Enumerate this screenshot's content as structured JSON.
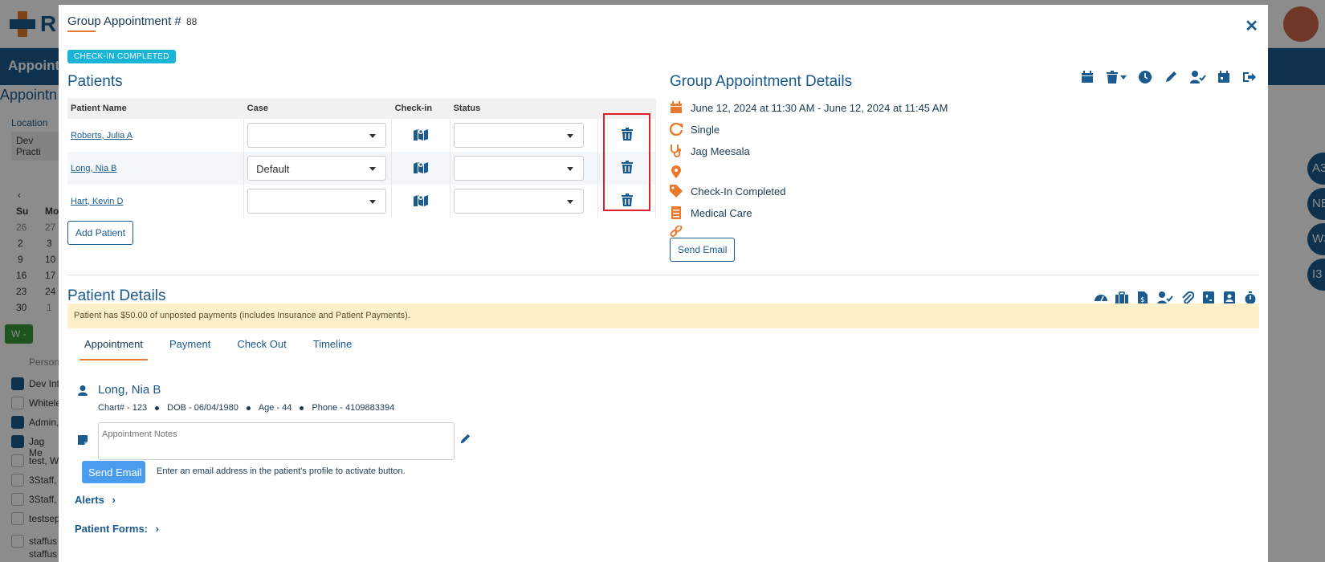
{
  "background": {
    "logo_text": "R",
    "nav_title": "Appoint",
    "side_title": "Appointn",
    "location_label": "Location",
    "location_value": "Dev Practi",
    "calendar": {
      "days": [
        "Su",
        "Mo"
      ],
      "rows": [
        [
          "26",
          "27"
        ],
        [
          "2",
          "3"
        ],
        [
          "9",
          "10"
        ],
        [
          "16",
          "17"
        ],
        [
          "23",
          "24"
        ],
        [
          "30",
          "1"
        ]
      ]
    },
    "week_button": "W -",
    "person_header": "Person",
    "staff": [
      "Dev Int",
      "Whitele",
      "Admin,",
      "Jag Me",
      "test, W",
      "3Staff,",
      "3Staff,",
      "testsep",
      "staffus",
      "staffus"
    ],
    "staff_checked": [
      true,
      false,
      true,
      true,
      false,
      false,
      false,
      false,
      false,
      false
    ],
    "right_circles": [
      "A3",
      "NE",
      "W3",
      "I3"
    ]
  },
  "modal": {
    "title": "Group Appointment #",
    "number": "88",
    "close_icon": "close-icon",
    "status_badge": "CHECK-IN COMPLETED",
    "patients": {
      "heading": "Patients",
      "columns": [
        "Patient Name",
        "Case",
        "Check-in",
        "Status",
        ""
      ],
      "rows": [
        {
          "name": "Roberts, Julia A",
          "case": ""
        },
        {
          "name": "Long, Nia B",
          "case": "Default"
        },
        {
          "name": "Hart, Kevin D",
          "case": ""
        }
      ],
      "add_button": "Add Patient"
    },
    "group_details": {
      "heading": "Group Appointment Details",
      "toolbar_icons": [
        "calendar-icon",
        "trash-dropdown-icon",
        "clock-icon",
        "pencil-icon",
        "user-check-icon",
        "calendar-alt-icon",
        "sign-out-icon"
      ],
      "date": "June 12, 2024 at 11:30 AM - June 12, 2024 at 11:45 AM",
      "recurrence": "Single",
      "provider": "Jag Meesala",
      "location": "",
      "status": "Check-In Completed",
      "type": "Medical Care",
      "link": "",
      "send_email": "Send Email"
    },
    "patient_details": {
      "heading": "Patient Details",
      "toolbar_icons": [
        "dashboard-icon",
        "briefcase-icon",
        "invoice-icon",
        "user-check-icon",
        "paperclip-icon",
        "phone-book-icon",
        "contact-icon",
        "stopwatch-icon"
      ],
      "alert": "Patient has $50.00 of unposted payments (includes Insurance and Patient Payments).",
      "tabs": [
        "Appointment",
        "Payment",
        "Check Out",
        "Timeline"
      ],
      "active_tab": "Appointment",
      "patient_name": "Long, Nia B",
      "chart": "Chart# - 123",
      "dob": "DOB - 06/04/1980",
      "age": "Age - 44",
      "phone": "Phone - 4109883394",
      "notes_placeholder": "Appointment Notes",
      "send_email": "Send Email",
      "email_hint": "Enter an email address in the patient's profile to activate button.",
      "alerts_label": "Alerts",
      "forms_label": "Patient Forms:"
    }
  },
  "colors": {
    "primary": "#1a5a8e",
    "accent": "#e87a2e",
    "badge": "#1ab5d6",
    "alert_bg": "#fdf0c9",
    "highlight": "#e0202a"
  }
}
